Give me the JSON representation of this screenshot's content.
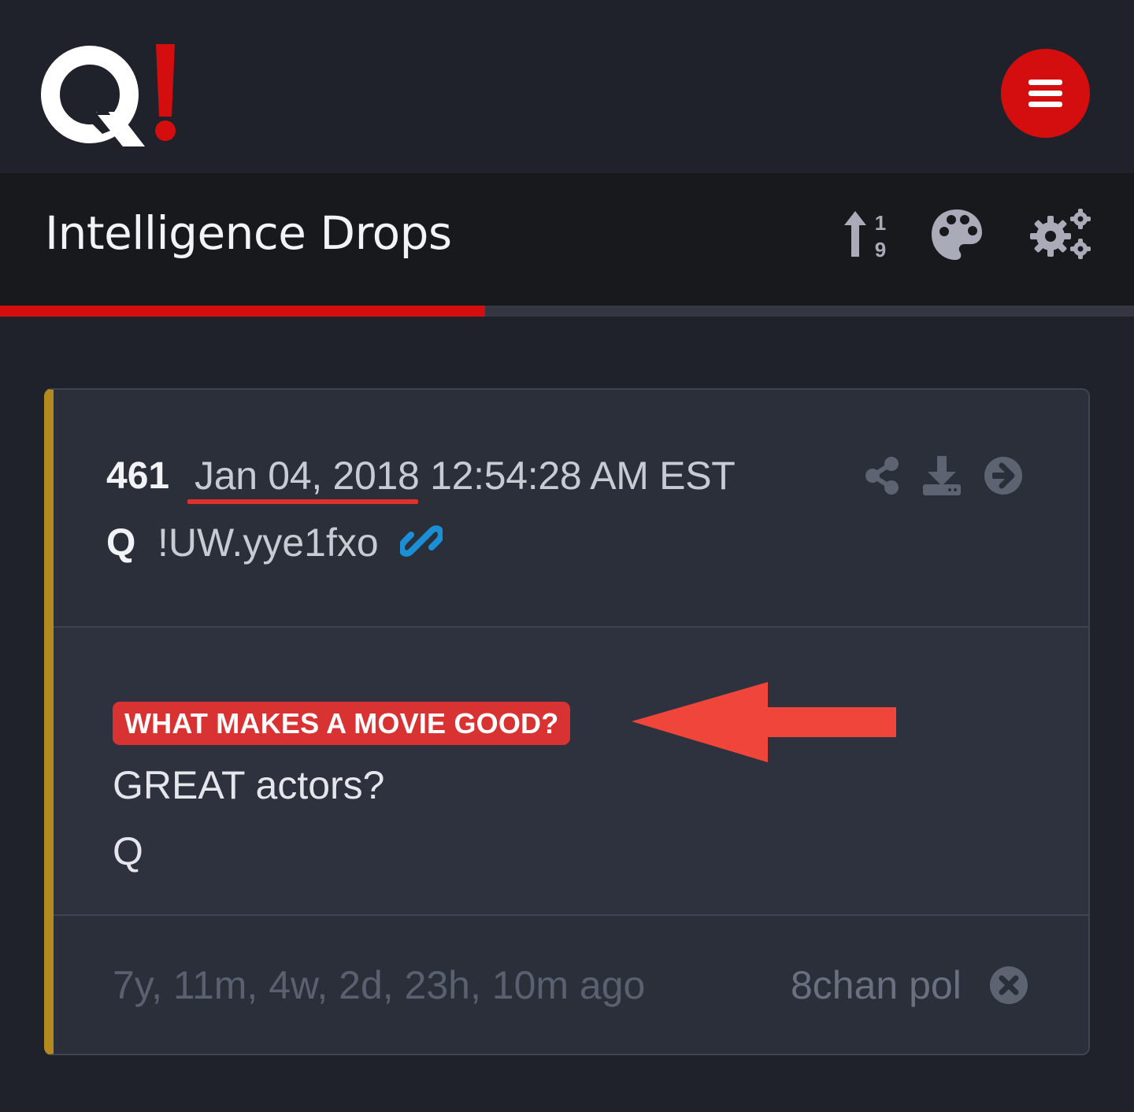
{
  "header": {
    "logo_icon": "q-exclamation-logo",
    "logo_colors": {
      "letter": "#ffffff",
      "mark": "#d40e0e"
    },
    "menu_icon": "hamburger-icon",
    "menu_color": "#d40e0e"
  },
  "titlebar": {
    "title": "Intelligence Drops",
    "icons": [
      "sort-numeric-icon",
      "palette-icon",
      "settings-cogs-icon"
    ],
    "progress_fraction": 0.428
  },
  "drop": {
    "number": "461",
    "date": "Jan 04, 2018 12:54:28 AM EST",
    "author": "Q",
    "tripcode": "!UW.yye1fxo",
    "head_icons": [
      "share-icon",
      "download-icon",
      "arrow-right-circle-icon"
    ],
    "link_icon": "link-icon",
    "subject": "WHAT MAKES A MOVIE GOOD?",
    "body_lines": [
      "GREAT actors?",
      "Q"
    ],
    "time_ago": "7y, 11m, 4w, 2d, 23h, 10m ago",
    "source": "8chan pol",
    "accent_color": "#b38a1f",
    "annotation_color": "#f0453a"
  }
}
